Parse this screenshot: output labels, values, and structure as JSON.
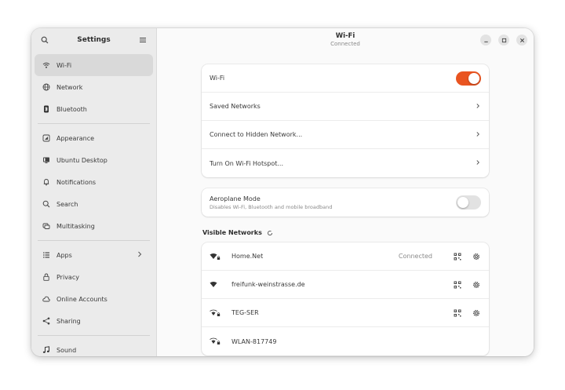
{
  "sidebar": {
    "title": "Settings",
    "search_icon": "search-icon",
    "menu_icon": "hamburger-menu-icon",
    "items": [
      {
        "label": "Wi-Fi",
        "icon": "wifi-icon",
        "active": true
      },
      {
        "label": "Network",
        "icon": "network-globe-icon"
      },
      {
        "label": "Bluetooth",
        "icon": "bluetooth-icon"
      },
      {
        "label": "Appearance",
        "icon": "appearance-icon"
      },
      {
        "label": "Ubuntu Desktop",
        "icon": "desktop-icon"
      },
      {
        "label": "Notifications",
        "icon": "bell-icon"
      },
      {
        "label": "Search",
        "icon": "search-icon"
      },
      {
        "label": "Multitasking",
        "icon": "multitasking-icon"
      },
      {
        "label": "Apps",
        "icon": "apps-grid-icon",
        "has_submenu": true
      },
      {
        "label": "Privacy",
        "icon": "lock-icon"
      },
      {
        "label": "Online Accounts",
        "icon": "cloud-icon"
      },
      {
        "label": "Sharing",
        "icon": "share-icon"
      },
      {
        "label": "Sound",
        "icon": "music-note-icon"
      }
    ]
  },
  "header": {
    "title": "Wi-Fi",
    "subtitle": "Connected"
  },
  "wifi_card": {
    "wifi_label": "Wi-Fi",
    "wifi_enabled": true,
    "saved_networks": "Saved Networks",
    "hidden_network": "Connect to Hidden Network...",
    "hotspot": "Turn On Wi-Fi Hotspot..."
  },
  "aeroplane": {
    "label": "Aeroplane Mode",
    "description": "Disables Wi-Fi, Bluetooth and mobile broadband",
    "enabled": false
  },
  "visible_networks": {
    "title": "Visible Networks",
    "networks": [
      {
        "name": "Home.Net",
        "status": "Connected",
        "secured": true,
        "qr": true,
        "settings": true
      },
      {
        "name": "freifunk-weinstrasse.de",
        "status": "",
        "secured": false,
        "qr": true,
        "settings": true
      },
      {
        "name": "TEG-SER",
        "status": "",
        "secured": true,
        "qr": true,
        "settings": true
      },
      {
        "name": "WLAN-817749",
        "status": "",
        "secured": true,
        "qr": false,
        "settings": false
      }
    ]
  },
  "colors": {
    "accent": "#e95420",
    "sidebar_bg": "#ebebeb",
    "active_item_bg": "#d9d9d9"
  }
}
